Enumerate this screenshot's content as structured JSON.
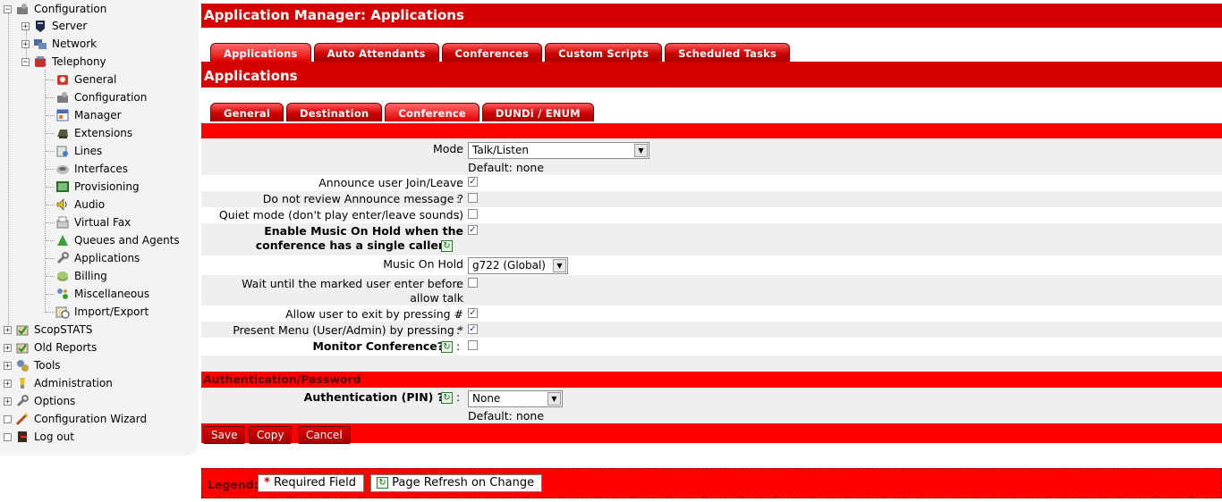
{
  "sidebar": {
    "items": [
      {
        "label": "Configuration",
        "icon": "configuration-icon",
        "toggle": "−"
      },
      {
        "label": "Server",
        "icon": "server-icon",
        "toggle": "+"
      },
      {
        "label": "Network",
        "icon": "network-icon",
        "toggle": "+"
      },
      {
        "label": "Telephony",
        "icon": "telephony-icon",
        "toggle": "−"
      },
      {
        "label": "General",
        "icon": "general-icon"
      },
      {
        "label": "Configuration",
        "icon": "configuration-icon"
      },
      {
        "label": "Manager",
        "icon": "manager-icon"
      },
      {
        "label": "Extensions",
        "icon": "extensions-icon"
      },
      {
        "label": "Lines",
        "icon": "lines-icon"
      },
      {
        "label": "Interfaces",
        "icon": "interfaces-icon"
      },
      {
        "label": "Provisioning",
        "icon": "provisioning-icon"
      },
      {
        "label": "Audio",
        "icon": "audio-icon"
      },
      {
        "label": "Virtual Fax",
        "icon": "virtual-fax-icon"
      },
      {
        "label": "Queues and Agents",
        "icon": "queues-icon"
      },
      {
        "label": "Applications",
        "icon": "applications-icon"
      },
      {
        "label": "Billing",
        "icon": "billing-icon"
      },
      {
        "label": "Miscellaneous",
        "icon": "miscellaneous-icon"
      },
      {
        "label": "Import/Export",
        "icon": "import-export-icon"
      },
      {
        "label": "ScopSTATS",
        "icon": "scopstats-icon",
        "toggle": "+"
      },
      {
        "label": "Old Reports",
        "icon": "old-reports-icon",
        "toggle": "+"
      },
      {
        "label": "Tools",
        "icon": "tools-icon",
        "toggle": "+"
      },
      {
        "label": "Administration",
        "icon": "administration-icon",
        "toggle": "+"
      },
      {
        "label": "Options",
        "icon": "options-icon",
        "toggle": "+"
      },
      {
        "label": "Configuration Wizard",
        "icon": "wizard-icon",
        "toggle": ""
      },
      {
        "label": "Log out",
        "icon": "logout-icon",
        "toggle": ""
      }
    ]
  },
  "header": {
    "title": "Application Manager:  Applications"
  },
  "main_tabs": [
    "Applications",
    "Auto Attendants",
    "Conferences",
    "Custom Scripts",
    "Scheduled Tasks"
  ],
  "section_title": "Applications",
  "sub_tabs": [
    "General",
    "Destination",
    "Conference",
    "DUNDi / ENUM"
  ],
  "form": {
    "mode": {
      "label": "Mode",
      "value": "Talk/Listen",
      "default": "Default: none"
    },
    "announce_join_leave": {
      "label": "Announce user Join/Leave",
      "checked": true
    },
    "no_review_announce": {
      "label": "Do not review Announce message ?",
      "checked": false
    },
    "quiet_mode": {
      "label": "Quiet mode (don't play enter/leave sounds)",
      "checked": false
    },
    "moh_single_caller": {
      "label_line1": "Enable Music On Hold when the",
      "label_line2": "conference has a single caller",
      "checked": true
    },
    "music_on_hold": {
      "label": "Music On Hold",
      "value": "g722 (Global)"
    },
    "wait_marked_user": {
      "label_line1": "Wait until the marked user enter before",
      "label_line2": "allow talk",
      "checked": false
    },
    "exit_pressing_hash": {
      "label": "Allow user to exit by pressing #",
      "checked": true
    },
    "present_menu": {
      "label": "Present Menu (User/Admin) by pressing *",
      "checked": true
    },
    "monitor_conference": {
      "label": "Monitor Conference?",
      "checked": false
    }
  },
  "auth": {
    "section_title": "Authentication/Password",
    "pin_label": "Authentication (PIN) ?",
    "pin_value": "None",
    "pin_default": "Default: none"
  },
  "buttons": {
    "save": "Save",
    "copy": "Copy",
    "cancel": "Cancel"
  },
  "legend": {
    "label": "Legend:",
    "required_mark": "*",
    "required": "Required Field",
    "refresh": "Page Refresh on Change"
  },
  "colors": {
    "brand_red": "#d40000",
    "bar_red": "#ff0000",
    "sidebar_bg": "#f3f3f3"
  }
}
